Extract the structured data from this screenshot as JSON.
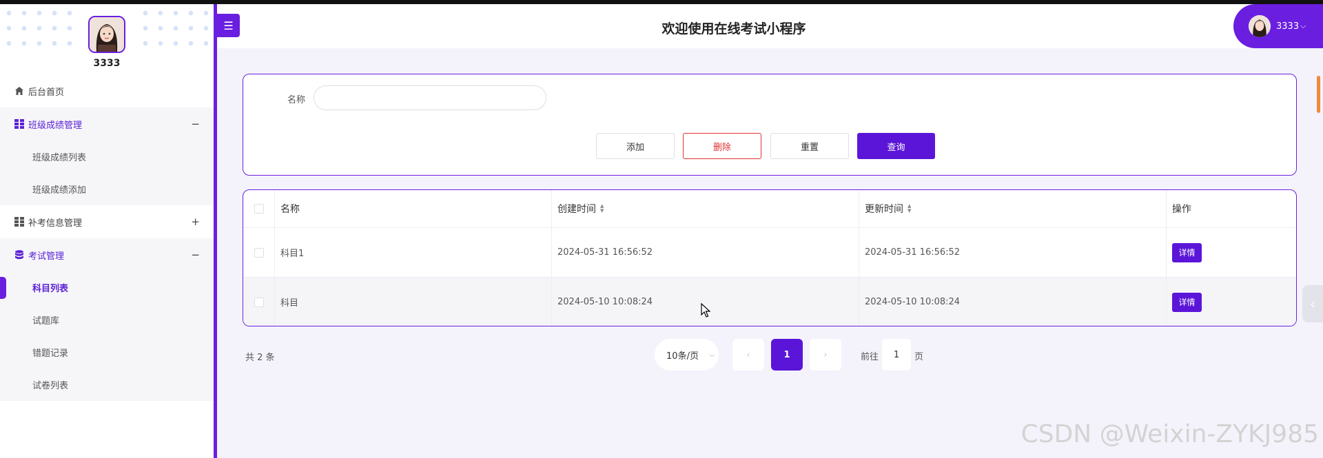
{
  "app": {
    "title": "欢迎使用在线考试小程序",
    "menu_icon": "☰"
  },
  "user": {
    "name": "3333",
    "chip_label": "3333",
    "chip_chevron": "⌵"
  },
  "sidebar": {
    "home": {
      "label": "后台首页",
      "icon": "home-icon"
    },
    "groups": [
      {
        "label": "班级成绩管理",
        "toggle": "−",
        "icon": "grid-icon",
        "items": [
          {
            "label": "班级成绩列表"
          },
          {
            "label": "班级成绩添加"
          }
        ]
      },
      {
        "label": "补考信息管理",
        "toggle": "+",
        "icon": "grid-icon",
        "items": []
      },
      {
        "label": "考试管理",
        "toggle": "−",
        "icon": "database-icon",
        "items": [
          {
            "label": "科目列表",
            "active": true
          },
          {
            "label": "试题库"
          },
          {
            "label": "错题记录"
          },
          {
            "label": "试卷列表"
          }
        ]
      }
    ]
  },
  "search": {
    "name_label": "名称",
    "name_value": "",
    "name_placeholder": "",
    "buttons": {
      "add": "添加",
      "delete": "删除",
      "reset": "重置",
      "query": "查询"
    }
  },
  "table": {
    "columns": [
      "名称",
      "创建时间",
      "更新时间",
      "操作"
    ],
    "rows": [
      {
        "name": "科目1",
        "created": "2024-05-31 16:56:52",
        "updated": "2024-05-31 16:56:52",
        "action": "详情"
      },
      {
        "name": "科目",
        "created": "2024-05-10 10:08:24",
        "updated": "2024-05-10 10:08:24",
        "action": "详情"
      }
    ]
  },
  "pagination": {
    "total": "共 2 条",
    "page_size": "10条/页",
    "prev": "‹",
    "current": "1",
    "next": "›",
    "goto_label": "前往",
    "goto_value": "1",
    "goto_suffix": "页"
  },
  "watermark": "CSDN @Weixin-ZYKJ985",
  "colors": {
    "accent": "#6a1ee0",
    "button_primary": "#5b15d8",
    "danger": "#d33333"
  }
}
